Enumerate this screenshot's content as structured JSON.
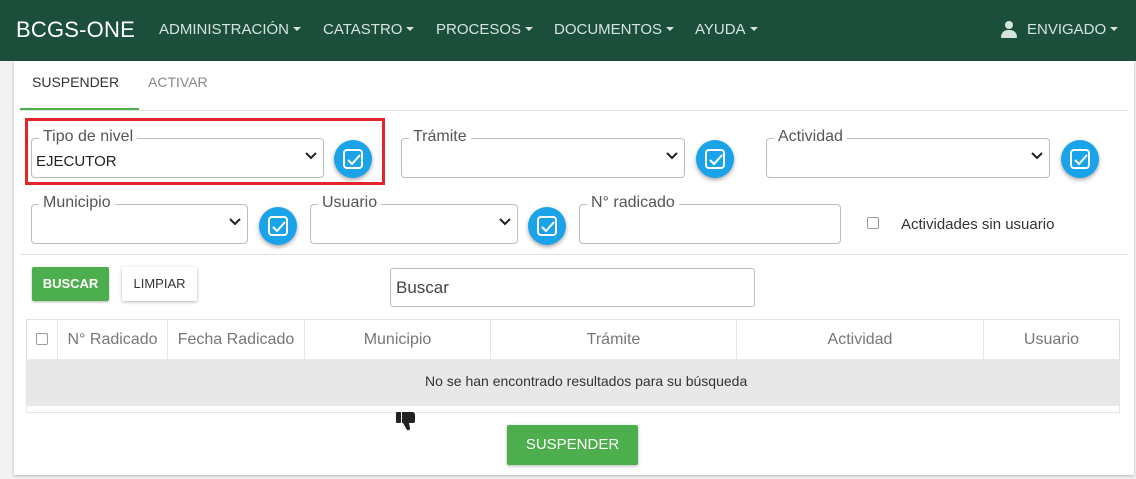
{
  "navbar": {
    "brand": "BCGS-ONE",
    "menu": [
      {
        "label": "ADMINISTRACIÓN"
      },
      {
        "label": "CATASTRO"
      },
      {
        "label": "PROCESOS"
      },
      {
        "label": "DOCUMENTOS"
      },
      {
        "label": "AYUDA"
      }
    ],
    "user": {
      "label": "ENVIGADO",
      "icon": "user-icon"
    },
    "background": "#1b4e3b"
  },
  "tabs": [
    {
      "label": "SUSPENDER",
      "active": true
    },
    {
      "label": "ACTIVAR",
      "active": false
    }
  ],
  "filters": {
    "tipo_nivel": {
      "label": "Tipo de nivel",
      "value": "EJECUTOR"
    },
    "tramite": {
      "label": "Trámite",
      "value": ""
    },
    "actividad": {
      "label": "Actividad",
      "value": ""
    },
    "municipio": {
      "label": "Municipio",
      "value": ""
    },
    "usuario": {
      "label": "Usuario",
      "value": ""
    },
    "radicado": {
      "label": "N° radicado",
      "value": ""
    },
    "sin_usuario": {
      "label": "Actividades sin usuario",
      "checked": false
    }
  },
  "actions": {
    "buscar": "BUSCAR",
    "limpiar": "LIMPIAR",
    "search_placeholder": "Buscar",
    "suspender": "SUSPENDER"
  },
  "table": {
    "columns": [
      "N° Radicado",
      "Fecha Radicado",
      "Municipio",
      "Trámite",
      "Actividad",
      "Usuario"
    ],
    "empty_message": "No se han encontrado resultados para su búsqueda"
  },
  "colors": {
    "primary_green": "#4cae4c",
    "check_blue": "#1aa3e8",
    "highlight_red": "#e1252b"
  }
}
